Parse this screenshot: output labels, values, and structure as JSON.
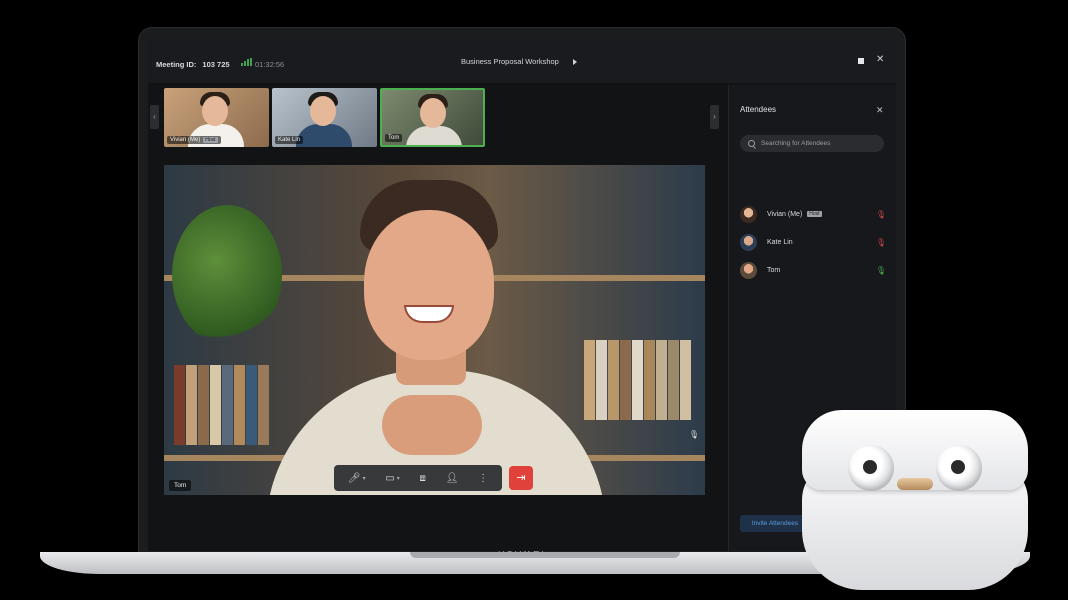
{
  "titlebar": {
    "meeting_id_label": "Meeting ID:",
    "meeting_id": "103 725",
    "elapsed": "01:32:56",
    "meeting_title": "Business Proposal Workshop"
  },
  "thumbnails": [
    {
      "name": "Vivian (Me)",
      "tag": "Host"
    },
    {
      "name": "Kate Lin"
    },
    {
      "name": "Tom"
    }
  ],
  "main_video": {
    "speaker": "Tom"
  },
  "attendees_panel": {
    "title": "Attendees",
    "search_placeholder": "Searching for Attendees",
    "attendees": [
      {
        "name": "Vivian (Me)",
        "tag": "Host",
        "mic": "muted"
      },
      {
        "name": "Kate Lin",
        "mic": "muted"
      },
      {
        "name": "Tom",
        "mic": "on"
      }
    ],
    "invite_label": "Invite Attendees"
  },
  "brand": "HUAWEI",
  "colors": {
    "accent_green": "#4caf50",
    "leave_red": "#e0413b",
    "mute_red": "#c7484a",
    "invite_blue": "#5c9bdc"
  }
}
